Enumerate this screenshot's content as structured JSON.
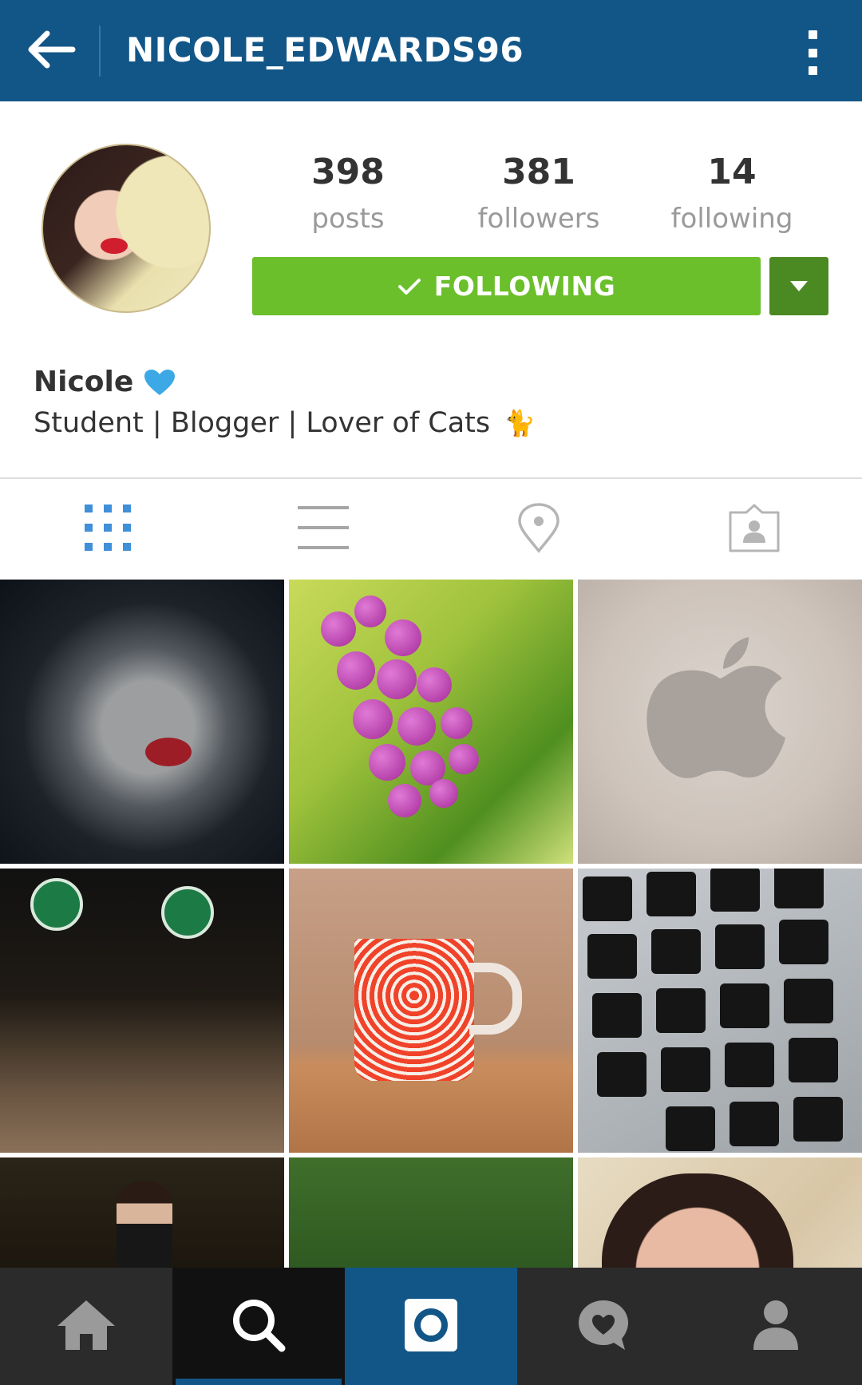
{
  "header": {
    "username": "NICOLE_EDWARDS96",
    "back_icon": "arrow-left-icon",
    "menu_icon": "more-vertical-icon"
  },
  "profile": {
    "stats": {
      "posts": {
        "count": "398",
        "label": "posts"
      },
      "followers": {
        "count": "381",
        "label": "followers"
      },
      "following": {
        "count": "14",
        "label": "following"
      }
    },
    "follow_button_label": "FOLLOWING",
    "name": "Nicole",
    "bio": "Student | Blogger | Lover of Cats",
    "bio_emoji": "🐈"
  },
  "view_tabs": [
    {
      "id": "grid",
      "icon": "grid-icon",
      "active": true
    },
    {
      "id": "list",
      "icon": "list-icon",
      "active": false
    },
    {
      "id": "map",
      "icon": "location-pin-icon",
      "active": false
    },
    {
      "id": "tagged",
      "icon": "tagged-photos-icon",
      "active": false
    }
  ],
  "photos": [
    {
      "subject": "selfie-red-lips"
    },
    {
      "subject": "purple-berries"
    },
    {
      "subject": "apple-logo"
    },
    {
      "subject": "starbucks-portrait"
    },
    {
      "subject": "red-tree-mug"
    },
    {
      "subject": "laptop-keyboard"
    },
    {
      "subject": "night-stairs-portrait"
    },
    {
      "subject": "pink-flowers"
    },
    {
      "subject": "close-up-face"
    }
  ],
  "bottom_nav": [
    {
      "id": "home",
      "icon": "home-icon",
      "active": false
    },
    {
      "id": "search",
      "icon": "search-icon",
      "active": true
    },
    {
      "id": "camera",
      "icon": "camera-icon",
      "active": false
    },
    {
      "id": "activity",
      "icon": "heart-bubble-icon",
      "active": false
    },
    {
      "id": "profile",
      "icon": "profile-icon",
      "active": false
    }
  ],
  "colors": {
    "header_blue": "#125688",
    "follow_green": "#6abf2b",
    "follow_green_dark": "#4b8a22",
    "active_tab_blue": "#3f8fd9",
    "heart_blue": "#3ca9e6",
    "nav_background": "#2b2b2b"
  }
}
